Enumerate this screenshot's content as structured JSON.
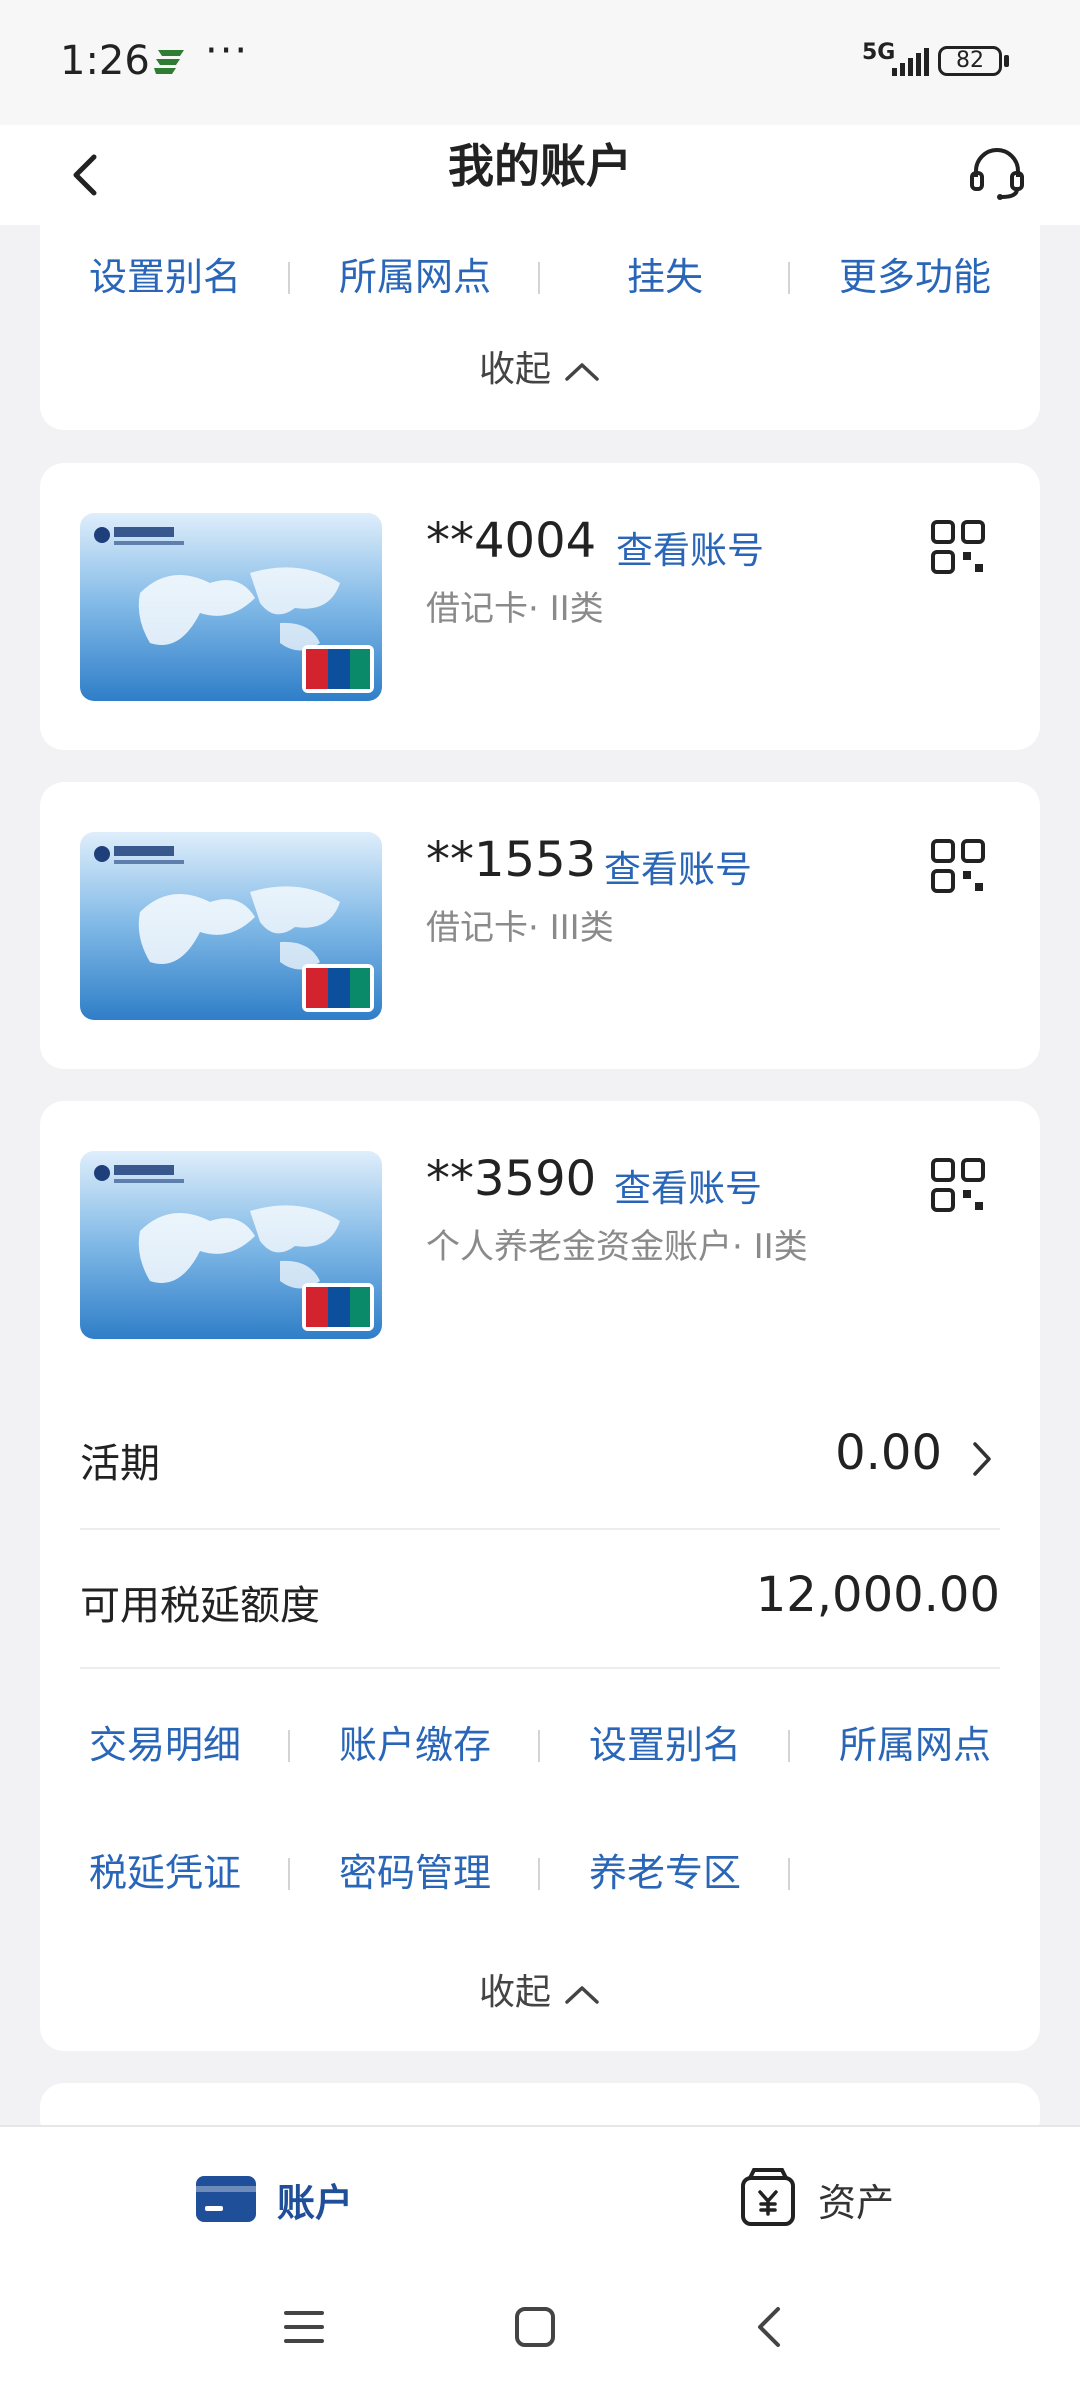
{
  "status_bar": {
    "time": "1:26",
    "more": "···",
    "network": "5G",
    "battery": "82"
  },
  "header": {
    "title": "我的账户"
  },
  "top_card": {
    "actions": [
      "设置别名",
      "所属网点",
      "挂失",
      "更多功能"
    ],
    "collapse_label": "收起"
  },
  "accounts": [
    {
      "number": "**4004",
      "view_label": "查看账号",
      "type": "借记卡· II类"
    },
    {
      "number": "**1553",
      "view_label": "查看账号",
      "type": "借记卡· III类"
    },
    {
      "number": "**3590",
      "view_label": "查看账号",
      "type": "个人养老金资金账户· II类"
    }
  ],
  "pension": {
    "demand_label": "活期",
    "demand_value": "0.00",
    "tax_quota_label": "可用税延额度",
    "tax_quota_value": "12,000.00",
    "actions_row1": [
      "交易明细",
      "账户缴存",
      "设置别名",
      "所属网点"
    ],
    "actions_row2": [
      "税延凭证",
      "密码管理",
      "养老专区"
    ],
    "collapse_label": "收起"
  },
  "bottom_nav": {
    "accounts_label": "账户",
    "assets_label": "资产"
  },
  "colors": {
    "accent": "#2a66b8",
    "nav_active": "#1f4f99",
    "background": "#f2f2f4"
  }
}
